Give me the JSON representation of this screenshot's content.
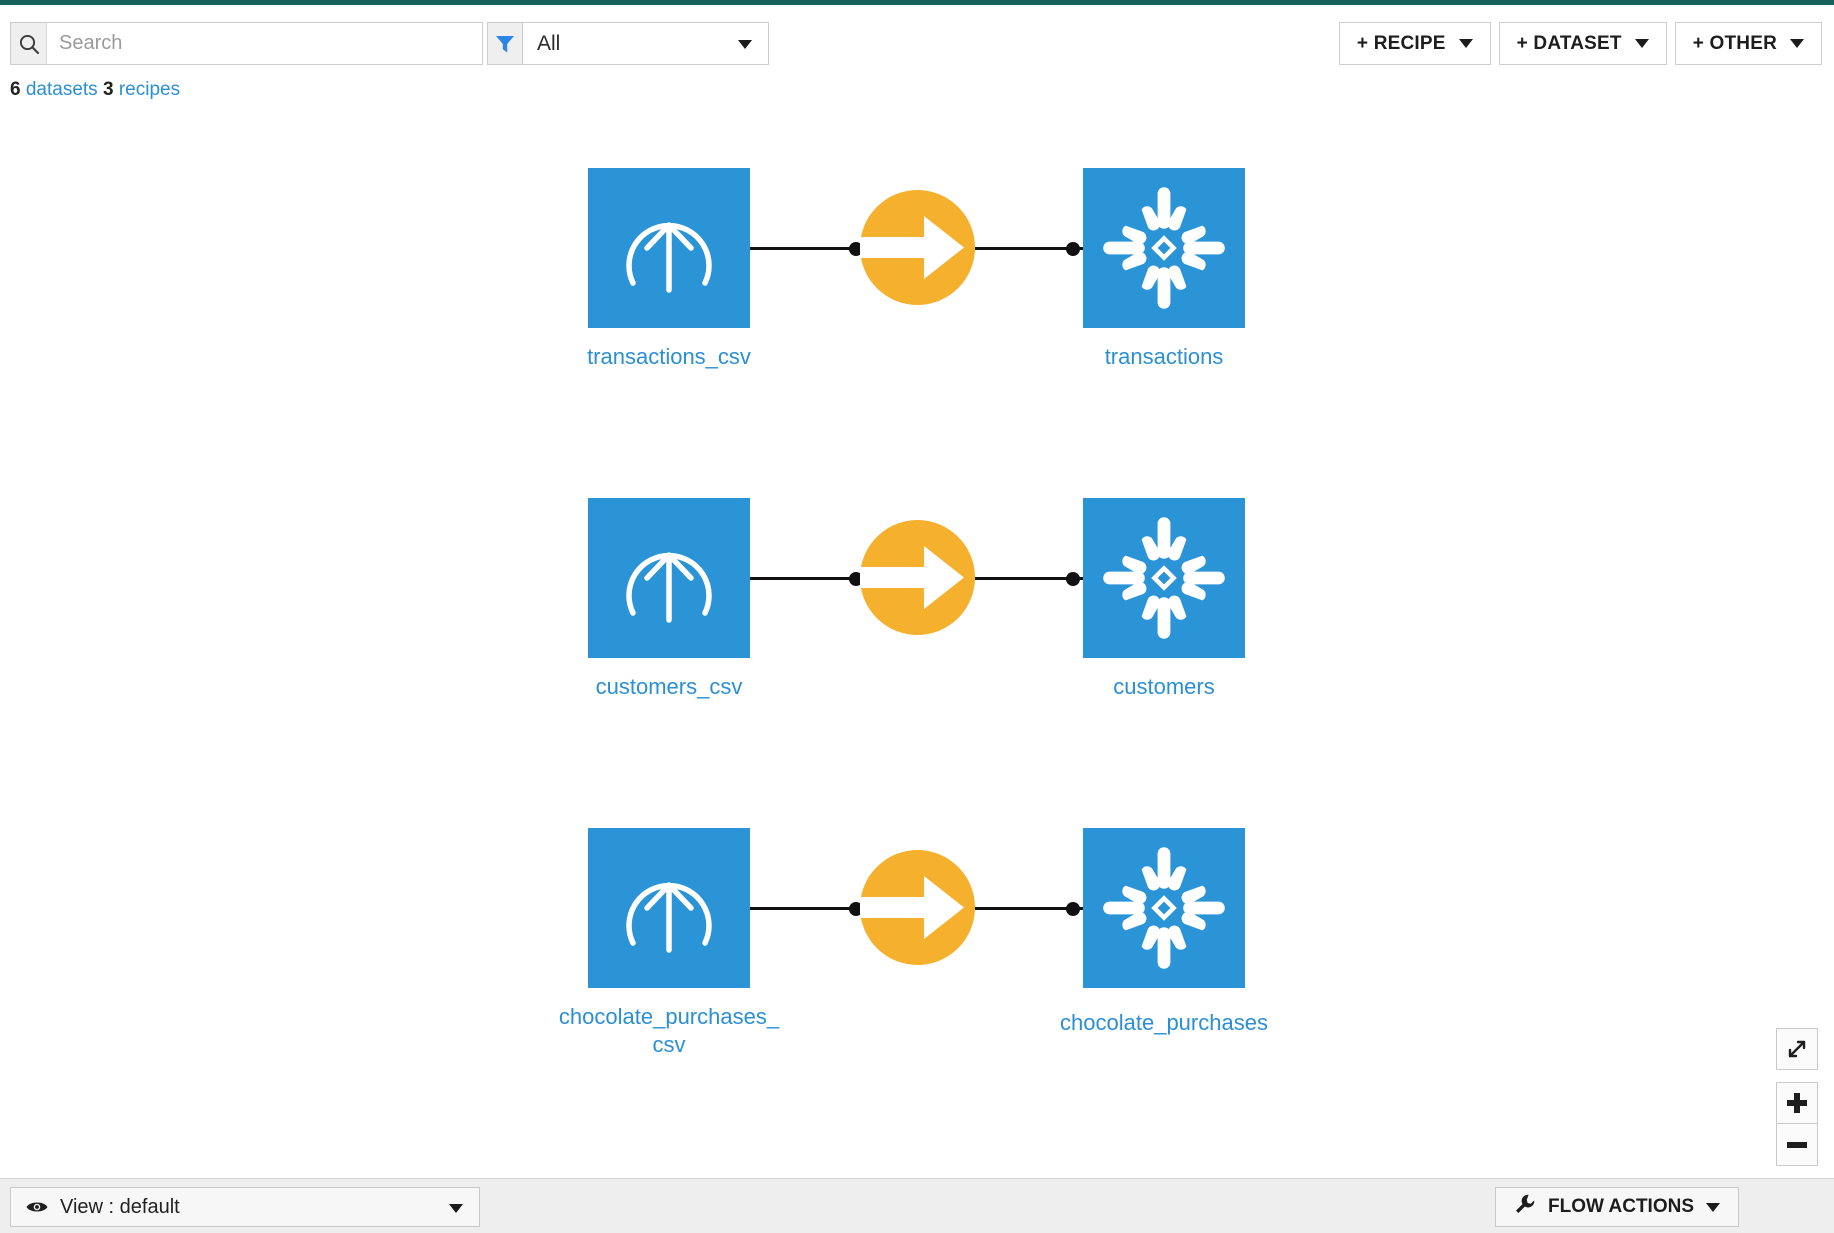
{
  "theme": {
    "accent_teal": "#16615c",
    "node_blue": "#2a94d6",
    "recipe_orange": "#f5b02e",
    "link_blue": "#2a8fd4"
  },
  "header": {
    "search": {
      "placeholder": "Search",
      "value": "",
      "icon": "search-icon"
    },
    "filter": {
      "icon": "filter-icon",
      "selected": "All"
    },
    "counts": {
      "datasets_number": "6",
      "datasets_label": "datasets",
      "recipes_number": "3",
      "recipes_label": "recipes"
    },
    "buttons": [
      {
        "label": "+ RECIPE",
        "icon": "chevron-down-icon"
      },
      {
        "label": "+ DATASET",
        "icon": "chevron-down-icon"
      },
      {
        "label": "+ OTHER",
        "icon": "chevron-down-icon"
      }
    ]
  },
  "flow": {
    "rows": [
      {
        "source": {
          "label": "transactions_csv",
          "icon": "upload-dataset-icon"
        },
        "recipe": {
          "icon": "sync-recipe-arrow-icon"
        },
        "target": {
          "label": "transactions",
          "icon": "snowflake-icon"
        }
      },
      {
        "source": {
          "label": "customers_csv",
          "icon": "upload-dataset-icon"
        },
        "recipe": {
          "icon": "sync-recipe-arrow-icon"
        },
        "target": {
          "label": "customers",
          "icon": "snowflake-icon"
        }
      },
      {
        "source": {
          "label": "chocolate_purchases_\ncsv",
          "icon": "upload-dataset-icon"
        },
        "recipe": {
          "icon": "sync-recipe-arrow-icon"
        },
        "target": {
          "label": "chocolate_purchases",
          "icon": "snowflake-icon"
        }
      }
    ]
  },
  "zoom_controls": {
    "fit": {
      "icon": "fit-to-screen-icon",
      "label": ""
    },
    "zoom_in": {
      "icon": "plus-icon",
      "label": ""
    },
    "zoom_out": {
      "icon": "minus-icon",
      "label": ""
    }
  },
  "bottom": {
    "view": {
      "icon": "eye-icon",
      "label": "View : default"
    },
    "flow_actions": {
      "icon": "wrench-icon",
      "label": "FLOW ACTIONS"
    }
  }
}
